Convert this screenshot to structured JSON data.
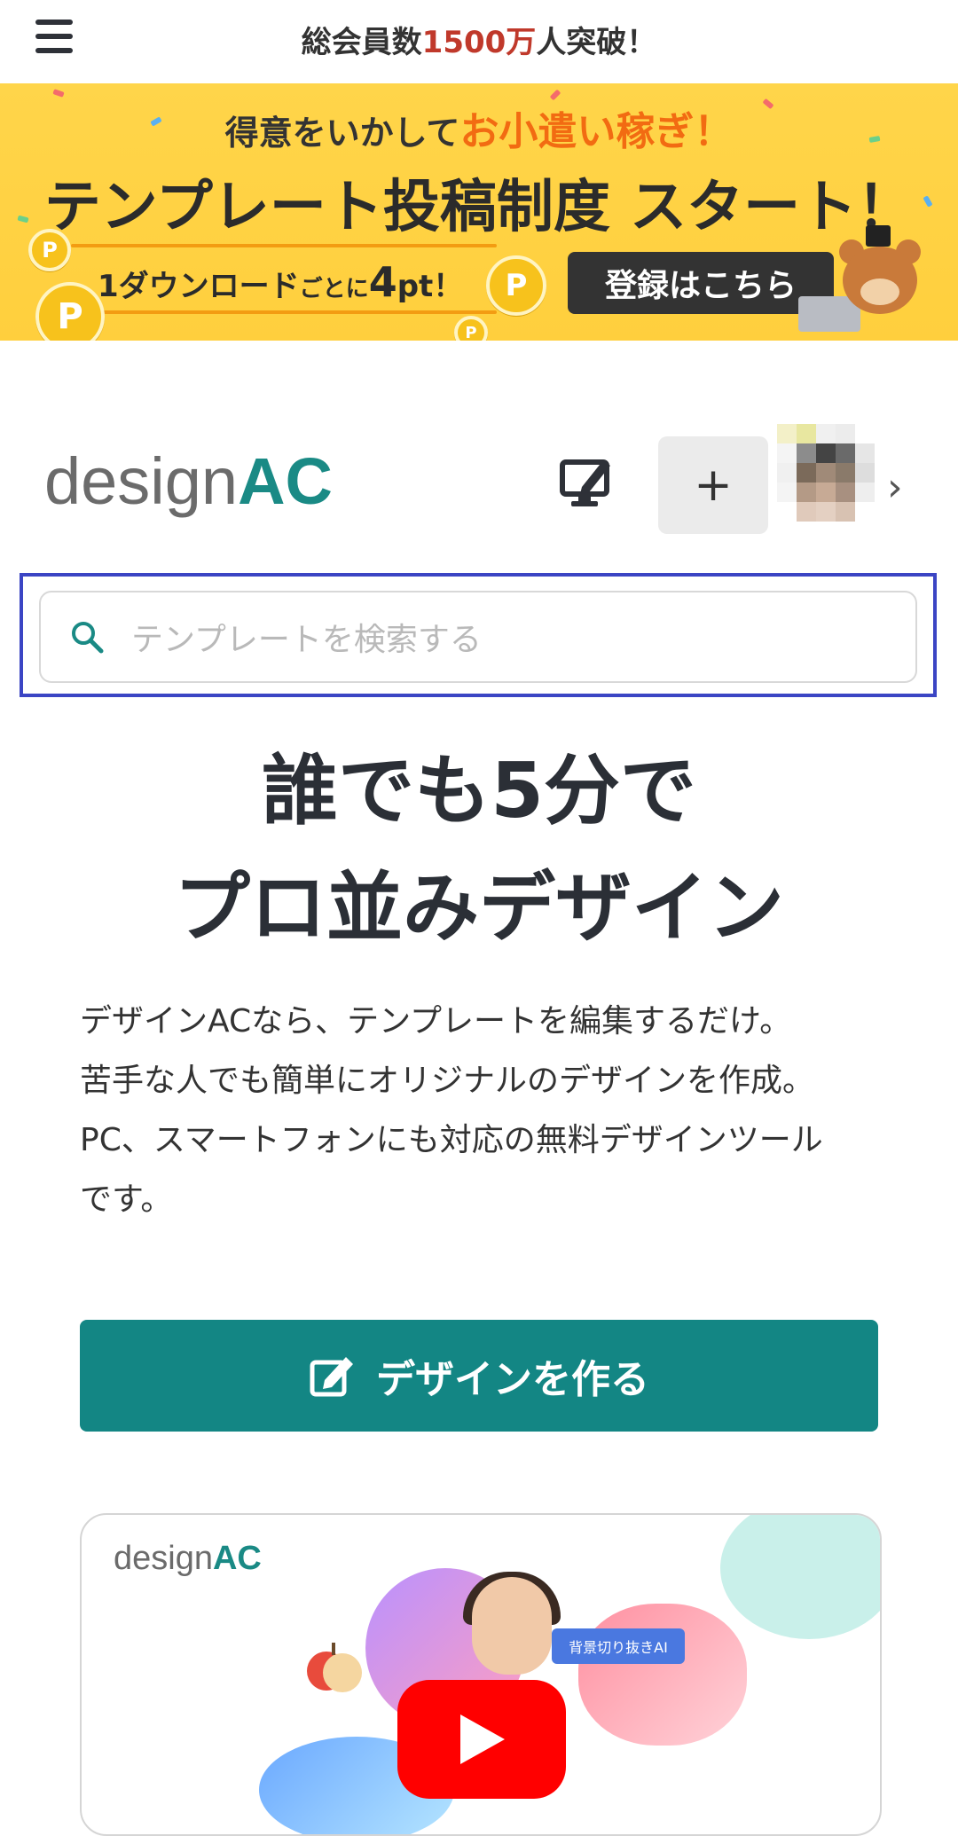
{
  "topbar": {
    "menu_icon": "hamburger-icon",
    "announce_prefix": "総会員数",
    "announce_highlight": "1500万",
    "announce_suffix": "人突破！"
  },
  "banner": {
    "line1_prefix": "得意をいかして",
    "line1_highlight": "お小遣い稼ぎ！",
    "line2": "テンプレート投稿制度 スタート！",
    "line3_a": "1ダウンロード",
    "line3_b": "ごとに",
    "line3_c": "4",
    "line3_d": "pt！",
    "register_label": "登録はこちら",
    "coin_label": "P"
  },
  "header": {
    "logo_design": "design",
    "logo_ac": "AC",
    "plus_label": "+",
    "chevron": "›"
  },
  "search": {
    "placeholder": "テンプレートを検索する",
    "value": ""
  },
  "hero": {
    "title_line1": "誰でも5分で",
    "title_line2": "プロ並みデザイン",
    "desc_line1": "デザインACなら、テンプレートを編集するだけ。",
    "desc_line2": "苦手な人でも簡単にオリジナルのデザインを作成。",
    "desc_line3": "PC、スマートフォンにも対応の無料デザインツール",
    "desc_line4": "です。"
  },
  "cta": {
    "label": "デザインを作る",
    "icon": "edit-icon"
  },
  "video": {
    "logo_design": "design",
    "logo_ac": "AC",
    "ai_tag": "背景切り抜きAI",
    "play_icon": "play-icon"
  },
  "colors": {
    "brand_teal": "#138684",
    "banner_yellow": "#ffd54a",
    "highlight_red": "#c0392b",
    "highlight_orange": "#f26b12",
    "search_outline": "#3b45c4"
  }
}
